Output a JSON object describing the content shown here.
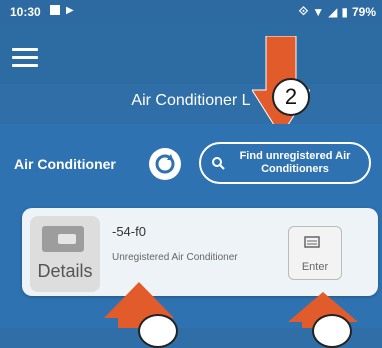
{
  "status": {
    "time": "10:30",
    "battery": "79%"
  },
  "header": {
    "title": "Air Conditioner L"
  },
  "annotations": {
    "step2": "2"
  },
  "section": {
    "label": "Air Conditioner",
    "find_button": "Find unregistered Air Conditioners"
  },
  "device": {
    "name": "-54-f0",
    "status": "Unregistered Air Conditioner",
    "details_label": "Details",
    "enter_label": "Enter"
  }
}
